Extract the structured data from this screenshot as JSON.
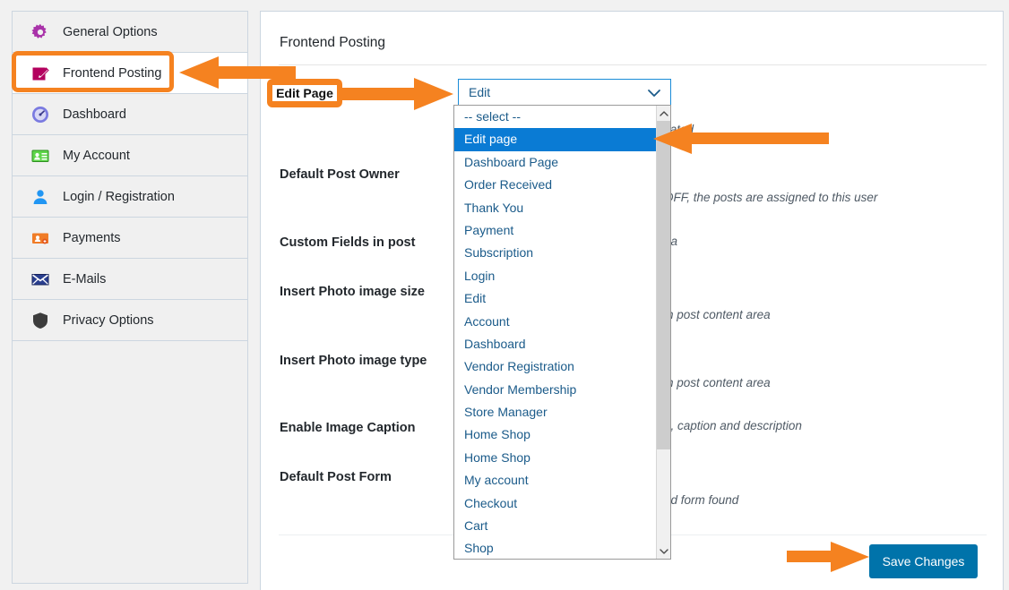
{
  "sidebar": {
    "items": [
      {
        "label": "General Options",
        "icon": "gear-icon",
        "active": false
      },
      {
        "label": "Frontend Posting",
        "icon": "pencil-note-icon",
        "active": true
      },
      {
        "label": "Dashboard",
        "icon": "gauge-icon",
        "active": false
      },
      {
        "label": "My Account",
        "icon": "id-card-icon",
        "active": false
      },
      {
        "label": "Login / Registration",
        "icon": "user-icon",
        "active": false
      },
      {
        "label": "Payments",
        "icon": "payment-card-icon",
        "active": false
      },
      {
        "label": "E-Mails",
        "icon": "envelope-icon",
        "active": false
      },
      {
        "label": "Privacy Options",
        "icon": "shield-icon",
        "active": false
      }
    ]
  },
  "header": {
    "title": "Frontend Posting"
  },
  "form": {
    "labels": [
      "Default Post Owner",
      "Custom Fields in post",
      "Insert Photo image size",
      "Insert Photo image type",
      "Enable Image Caption",
      "Default Post Form"
    ],
    "hints": [
      "cated",
      "OFF, the posts are assigned to this user",
      "ea",
      "in post content area",
      "in post content area",
      "e, caption and description",
      "ed form found"
    ]
  },
  "select": {
    "value": "Edit",
    "caret": "chevron-down-icon",
    "options": [
      "-- select --",
      "Edit page",
      "Dashboard Page",
      "Order Received",
      "Thank You",
      "Payment",
      "Subscription",
      "Login",
      "Edit",
      "Account",
      "Dashboard",
      "Vendor Registration",
      "Vendor Membership",
      "Store Manager",
      "Home Shop",
      "Home Shop",
      "My account",
      "Checkout",
      "Cart",
      "Shop"
    ],
    "selected_index": 1
  },
  "annotations": {
    "edit_page_badge": "Edit Page",
    "accent_color": "#f58220"
  },
  "footer": {
    "save_label": "Save Changes",
    "save_color": "#0073aa"
  }
}
